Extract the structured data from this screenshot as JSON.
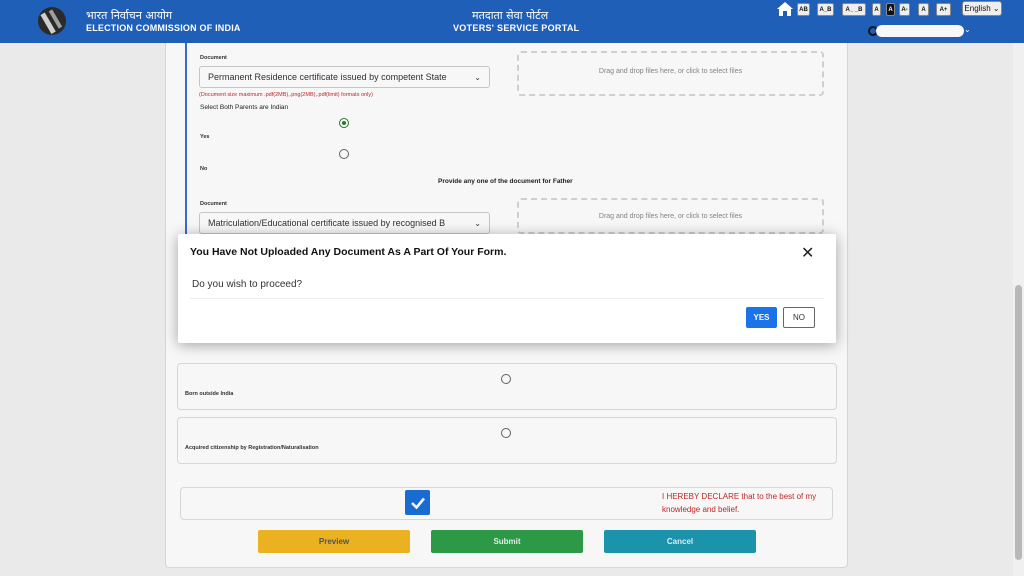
{
  "header": {
    "eci_hindi": "भारत निर्वाचन आयोग",
    "eci_english": "ELECTION COMMISSION OF INDIA",
    "portal_hindi": "मतदाता सेवा पोर्टल",
    "portal_english": "VOTERS' SERVICE PORTAL",
    "accessibility": [
      "AB",
      "A_B",
      "A_ _B",
      "A",
      "A",
      "A-",
      "A",
      "A+"
    ],
    "language": "English",
    "brand_color": "#1f5fb8"
  },
  "form": {
    "doc_label_1": "Document",
    "doc_select_1": "Permanent Residence certificate issued by competent State",
    "dropzone_1": "Drag and drop files here, or click to select files",
    "size_note": "(Document size maximum .pdf(2MB),.png(2MB),.pdf(limit) formats only)",
    "parents_label": "Select Both Parents are Indian",
    "yes_label": "Yes",
    "no_label": "No",
    "father_heading": "Provide any one of the document for Father",
    "doc_label_2": "Document",
    "doc_select_2": "Matriculation/Educational certificate issued by recognised B",
    "dropzone_2": "Drag and drop files here, or click to select files",
    "born_outside": "Born outside India",
    "acquired_citizenship": "Acquired citizenship by Registration/Naturalisation",
    "declaration": "I HEREBY DECLARE that to the best of my knowledge and belief.",
    "preview": "Preview",
    "submit": "Submit",
    "cancel": "Cancel"
  },
  "modal": {
    "title": "You Have Not Uploaded Any Document As A Part Of Your Form.",
    "body": "Do you wish to proceed?",
    "yes": "YES",
    "no": "NO",
    "close_icon": "close-icon"
  }
}
